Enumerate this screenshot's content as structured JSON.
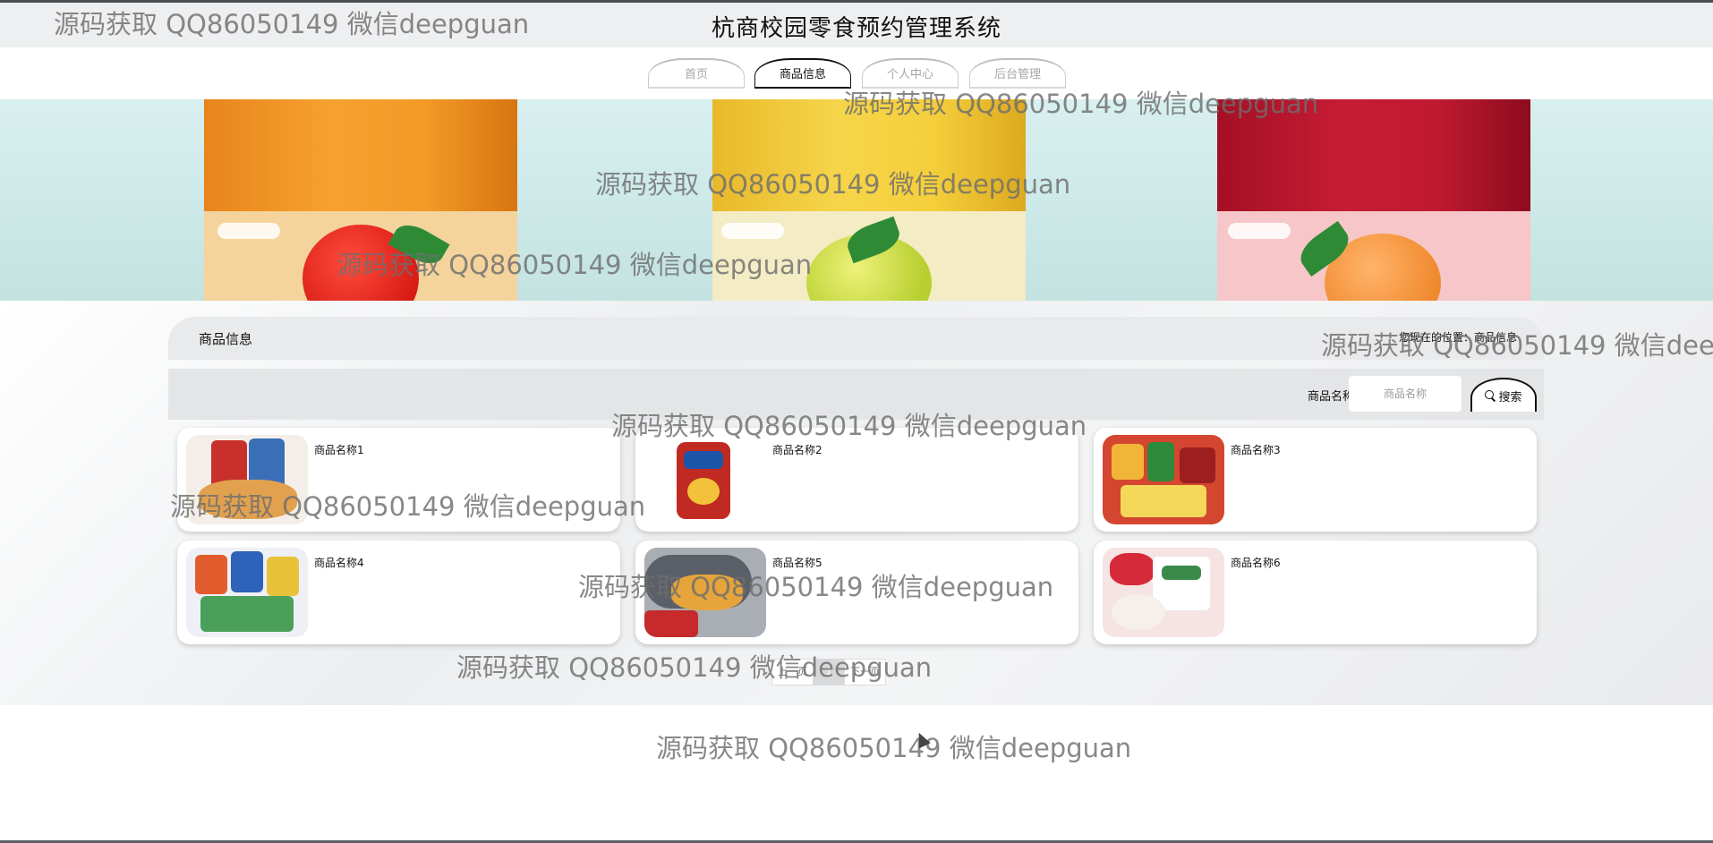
{
  "header": {
    "title": "杭商校园零食预约管理系统"
  },
  "nav": {
    "items": [
      {
        "label": "首页"
      },
      {
        "label": "商品信息"
      },
      {
        "label": "个人中心"
      },
      {
        "label": "后台管理"
      }
    ],
    "active_index": 1
  },
  "breadcrumb": {
    "title": "商品信息",
    "location": "您现在的位置：商品信息"
  },
  "search": {
    "label": "商品名称",
    "placeholder": "商品名称",
    "button_label": "搜索"
  },
  "products": [
    {
      "name": "商品名称1"
    },
    {
      "name": "商品名称2"
    },
    {
      "name": "商品名称3"
    },
    {
      "name": "商品名称4"
    },
    {
      "name": "商品名称5"
    },
    {
      "name": "商品名称6"
    }
  ],
  "pagination": {
    "prev_label": "上一页",
    "current_page": "1",
    "next_label": "下一页"
  },
  "watermark": {
    "text": "源码获取 QQ86050149 微信deepguan"
  },
  "colors": {
    "header_bg": "#eeeff1",
    "accent": "#111111",
    "content_bg": "#eceef0"
  }
}
